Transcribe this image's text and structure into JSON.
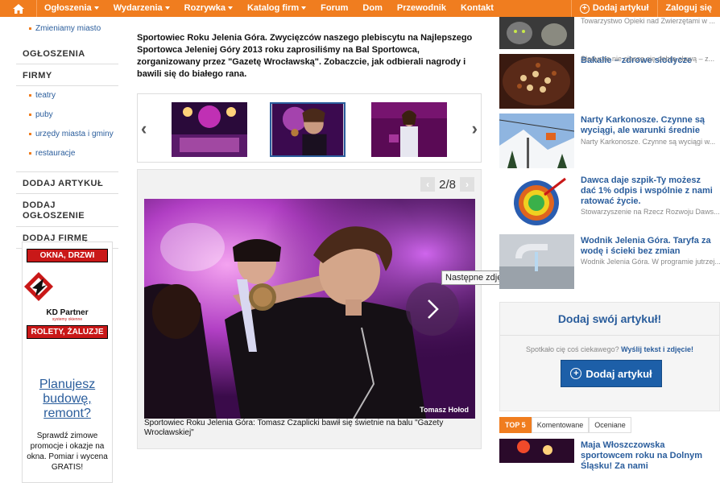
{
  "nav": {
    "items": [
      {
        "label": "Ogłoszenia",
        "dropdown": true
      },
      {
        "label": "Wydarzenia",
        "dropdown": true
      },
      {
        "label": "Rozrywka",
        "dropdown": true
      },
      {
        "label": "Katalog firm",
        "dropdown": true
      },
      {
        "label": "Forum",
        "dropdown": false
      },
      {
        "label": "Dom",
        "dropdown": false
      },
      {
        "label": "Przewodnik",
        "dropdown": false
      },
      {
        "label": "Kontakt",
        "dropdown": false
      }
    ],
    "add_article": "Dodaj artykuł",
    "login": "Zaloguj się",
    "accent_color": "#f07d1f"
  },
  "sidebar": {
    "top_link": "Zmieniamy miasto",
    "head_ogloszenia": "OGŁOSZENIA",
    "head_firmy": "FIRMY",
    "firmy_links": [
      "teatry",
      "puby",
      "urzędy miasta i gminy",
      "restauracje"
    ],
    "head_dodaj_artykul": "DODAJ ARTYKUŁ",
    "head_dodaj_ogloszenie": "DODAJ OGŁOSZENIE",
    "head_dodaj_firme": "DODAJ FIRMĘ"
  },
  "ad": {
    "top_banner": "OKNA, DRZWI",
    "brand": "KD Partner",
    "brand_sub": "systemy okienne",
    "bottom_banner": "ROLETY, ŻALUZJE",
    "link": "Planujesz budowę, remont?",
    "small_text": "Sprawdź zimowe promocje i okazje na okna. Pomiar i wycena GRATIS!"
  },
  "article": {
    "lead": "Sportowiec Roku Jelenia Góra. Zwycięzców naszego plebiscytu na Najlepszego Sportowca Jeleniej Góry 2013 roku zaprosiliśmy na Bal Sportowca, zorganizowany przez \"Gazetę Wrocławską\". Zobaczcie, jak odbierali nagrody i bawili się do białego rana."
  },
  "gallery": {
    "counter": "2/8",
    "prev_arrow": "‹",
    "next_arrow": "›",
    "tooltip": "Następne zdjęcie",
    "photo_credit": "Tomasz Hołod",
    "caption": "Sportowiec Roku Jelenia Góra: Tomasz Czaplicki bawił się świetnie na balu \"Gazety Wrocławskiej\"",
    "active_thumb_index": 1
  },
  "right": {
    "top_desc": "Towarzystwo Opieki nad Zwierzętami w ...",
    "items": [
      {
        "title": "Bakalie – zdrowe słodycze",
        "desc": "Słodycze nie cieszą się dobrą sławą – z...",
        "icon": "nuts-photo"
      },
      {
        "title": "Narty Karkonosze. Czynne są wyciągi, ale warunki średnie",
        "desc": "Narty Karkonosze. Czynne są wyciągi w...",
        "icon": "ski-lift-photo"
      },
      {
        "title": "Dawca daje szpik-Ty możesz dać 1% odpis i wspólnie z nami ratować życie.",
        "desc": "Stowarzyszenie na Rzecz Rozwoju Daws...",
        "icon": "target-photo"
      },
      {
        "title": "Wodnik Jelenia Góra. Taryfa za wodę i ścieki bez zmian",
        "desc": "Wodnik Jelenia Góra. W programie jutrzej...",
        "icon": "faucet-photo"
      }
    ],
    "submit_title": "Dodaj swój artykuł!",
    "submit_text_prefix": "Spotkało cię coś ciekawego?",
    "submit_text_link": "Wyślij tekst i zdjęcie!",
    "submit_button": "Dodaj artykuł",
    "tabs": [
      "TOP 5",
      "Komentowane",
      "Oceniane"
    ],
    "bottom_title": "Maja Włoszczowska sportowcem roku na Dolnym Śląsku! Za nami"
  }
}
